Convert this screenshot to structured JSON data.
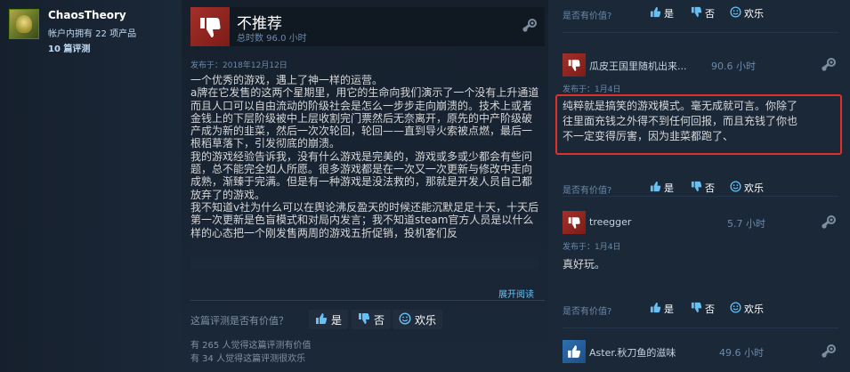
{
  "profile": {
    "username": "ChaosTheory",
    "owned": "帐户内拥有 22 项产品",
    "reviews": "10 篇评测"
  },
  "review": {
    "verdict": "不推荐",
    "hours": "总时数 96.0 小时",
    "posted": "发布于：2018年12月12日",
    "paragraphs": [
      "一个优秀的游戏，遇上了神一样的运营。",
      "a牌在它发售的这两个星期里，用它的生命向我们演示了一个没有上升通道而且人口可以自由流动的阶级社会是怎么一步步走向崩溃的。技术上或者金钱上的下层阶级被中上层收割完门票然后无奈离开，原先的中产阶级破产成为新的韭菜，然后一次次轮回，轮回——直到导火索被点燃，最后一根稻草落下，引发彻底的崩溃。",
      "我的游戏经验告诉我，没有什么游戏是完美的，游戏或多或少都会有些问题，总不能完全如人所愿。很多游戏都是在一次又一次更新与修改中走向成熟，渐臻于完满。但是有一种游戏是没法救的，那就是开发人员自己都放弃了的游戏。",
      "我不知道v社为什么可以在舆论沸反盈天的时候还能沉默足足十天，十天后第一次更新是色盲模式和对局内发言；我不知道steam官方人员是以什么样的心态把一个刚发售两周的游戏五折促销，投机客们反"
    ],
    "expand": "展开阅读",
    "helpful_question": "这篇评测是否有价值？",
    "buttons": {
      "yes": "是",
      "no": "否",
      "funny": "欢乐"
    },
    "helpful_count": "有 265 人觉得这篇评测有价值",
    "funny_count": "有 34 人觉得这篇评测很欢乐"
  },
  "comments_panel": {
    "top_question": "是否有价值?",
    "top_buttons": {
      "yes": "是",
      "no": "否",
      "funny": "欢乐"
    },
    "items": [
      {
        "name": "瓜皮王国里随机出来...",
        "hours": "90.6 小时",
        "posted": "发布于：1月4日",
        "text": "纯粹就是搞笑的游戏模式。毫无成就可言。你除了往里面充钱之外得不到任何回报，而且充钱了你也不一定变得厉害，因为韭菜都跑了、",
        "text_lines": [
          "纯粹就是搞笑的游戏模式。毫无成就可言。你除了",
          "往里面充钱之外得不到任何回报，而且充钱了你也",
          "不一定变得厉害，因为韭菜都跑了、"
        ],
        "question": "是否有价值?",
        "buttons": {
          "yes": "是",
          "no": "否",
          "funny": "欢乐"
        }
      },
      {
        "name": "treegger",
        "hours": "5.7 小时",
        "posted": "发布于：1月4日",
        "text": "真好玩。",
        "question": "是否有价值?",
        "buttons": {
          "yes": "是",
          "no": "否",
          "funny": "欢乐"
        }
      },
      {
        "name": "Aster.秋刀鱼的滋味",
        "hours": "49.6 小时"
      }
    ]
  },
  "colors": {
    "background": "#1b2838",
    "accent": "#66c0f4",
    "thumb_down": "#a3302a",
    "highlight_border": "#e0302a"
  },
  "icons": [
    "steam-logo-icon",
    "thumb-down-icon",
    "thumb-up-icon",
    "smiley-icon"
  ]
}
